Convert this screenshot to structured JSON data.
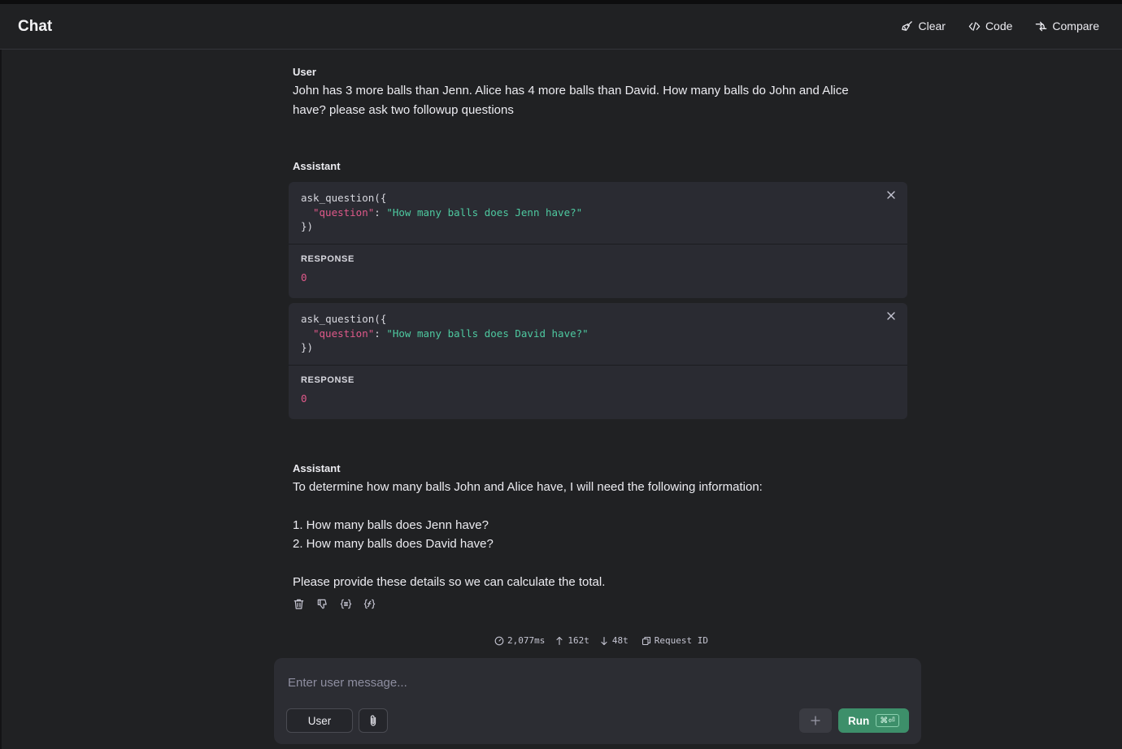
{
  "header": {
    "title": "Chat",
    "actions": [
      {
        "label": "Clear",
        "icon": "broom-icon"
      },
      {
        "label": "Code",
        "icon": "code-icon"
      },
      {
        "label": "Compare",
        "icon": "compare-icon"
      }
    ]
  },
  "messages": {
    "user": {
      "role": "User",
      "text": "John has 3 more balls than Jenn. Alice has 4 more balls than David.  How many balls do John and Alice have?  please ask two followup questions"
    },
    "assistant_tools": {
      "role": "Assistant",
      "calls": [
        {
          "open": "ask_question({",
          "key": "\"question\"",
          "colon": ": ",
          "value": "\"How many balls does Jenn have?\"",
          "close": "})",
          "response_label": "RESPONSE",
          "response_value": "0"
        },
        {
          "open": "ask_question({",
          "key": "\"question\"",
          "colon": ": ",
          "value": "\"How many balls does David have?\"",
          "close": "})",
          "response_label": "RESPONSE",
          "response_value": "0"
        }
      ]
    },
    "assistant_reply": {
      "role": "Assistant",
      "line1": "To determine how many balls John and Alice have, I will need the following information:",
      "item1": "1. How many balls does Jenn have?",
      "item2": "2. How many balls does David have?",
      "line2": "Please provide these details so we can calculate the total."
    }
  },
  "stats": {
    "latency": "2,077ms",
    "tokens_in": "162t",
    "tokens_out": "48t",
    "request_id": "Request ID"
  },
  "composer": {
    "placeholder": "Enter user message...",
    "role_label": "User",
    "run_label": "Run",
    "shortcut": "⌘⏎"
  }
}
